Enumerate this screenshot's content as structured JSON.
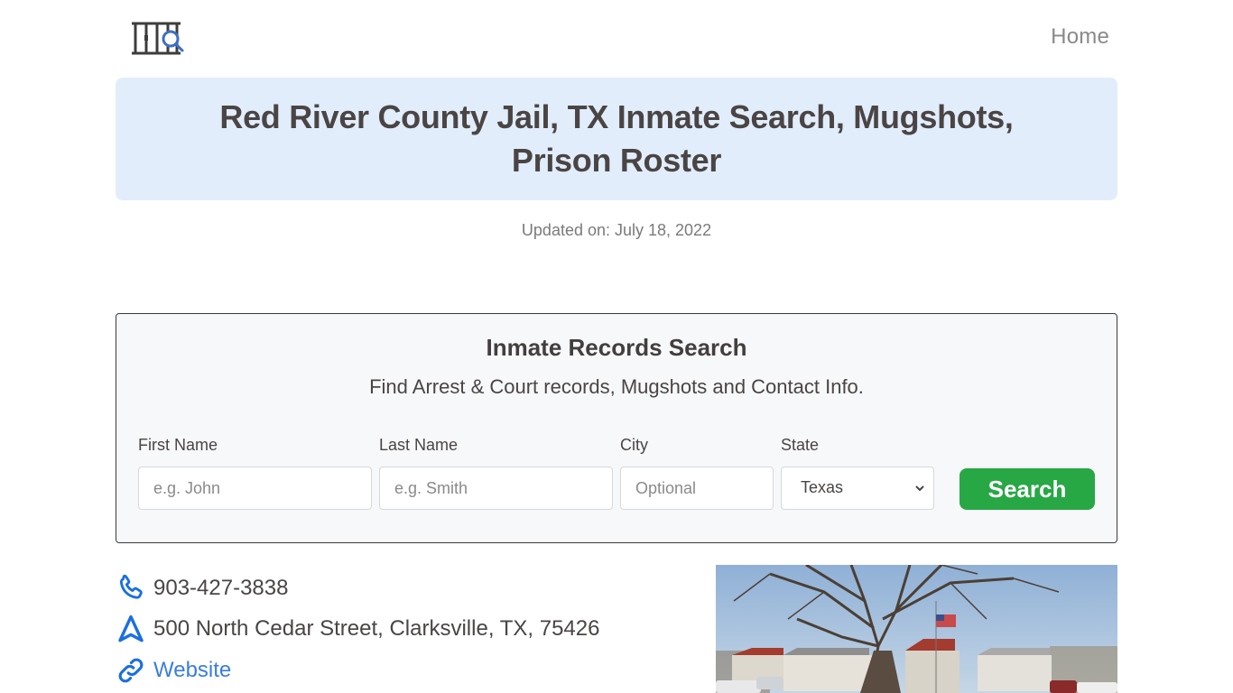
{
  "nav": {
    "logo_alt": "jail bars with magnifier logo",
    "home_label": "Home"
  },
  "header": {
    "title": "Red River County Jail, TX Inmate Search, Mugshots, Prison Roster",
    "updated": "Updated on: July 18, 2022"
  },
  "search": {
    "title": "Inmate Records Search",
    "subtitle": "Find Arrest & Court records, Mugshots and Contact Info.",
    "fields": {
      "first_name": {
        "label": "First Name",
        "placeholder": "e.g. John",
        "value": ""
      },
      "last_name": {
        "label": "Last Name",
        "placeholder": "e.g. Smith",
        "value": ""
      },
      "city": {
        "label": "City",
        "placeholder": "Optional",
        "value": ""
      },
      "state": {
        "label": "State",
        "selected": "Texas"
      }
    },
    "button_label": "Search",
    "button_color": "#28a745"
  },
  "contact": {
    "phone": "903-427-3838",
    "address": "500 North Cedar Street, Clarksville, TX, 75426",
    "website_label": "Website",
    "icon_color": "#1a6fe0",
    "icons": [
      "phone-icon",
      "navigation-arrow-icon",
      "link-icon"
    ]
  },
  "photo": {
    "alt": "Red River County Jail building exterior with bare tree and American flag"
  },
  "colors": {
    "banner_bg": "#e2edfc",
    "text": "#4a4544",
    "link": "#3b7ddd"
  }
}
